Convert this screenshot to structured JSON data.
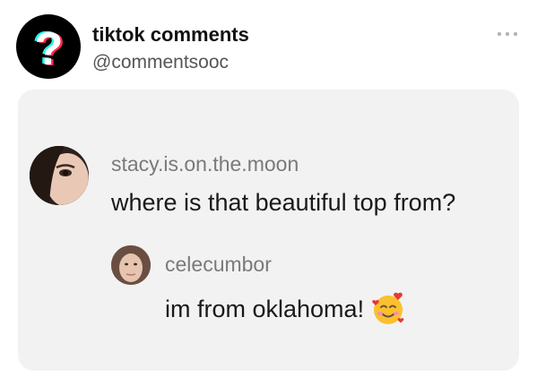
{
  "post": {
    "account_name": "tiktok comments",
    "account_handle": "@commentsooc",
    "avatar_icon": "tiktok-question-mark-icon",
    "more_icon": "more-dots-icon"
  },
  "comment": {
    "username": "stacy.is.on.the.moon",
    "text": "where is that beautiful top from?"
  },
  "reply": {
    "username": "celecumbor",
    "text": "im from oklahoma!",
    "emoji_icon": "smiling-face-with-hearts-icon"
  },
  "colors": {
    "card_background": "#f2f2f2",
    "username_gray": "#7a7a7a",
    "tiktok_cyan": "#25f4ee",
    "tiktok_red": "#fe2c55"
  }
}
